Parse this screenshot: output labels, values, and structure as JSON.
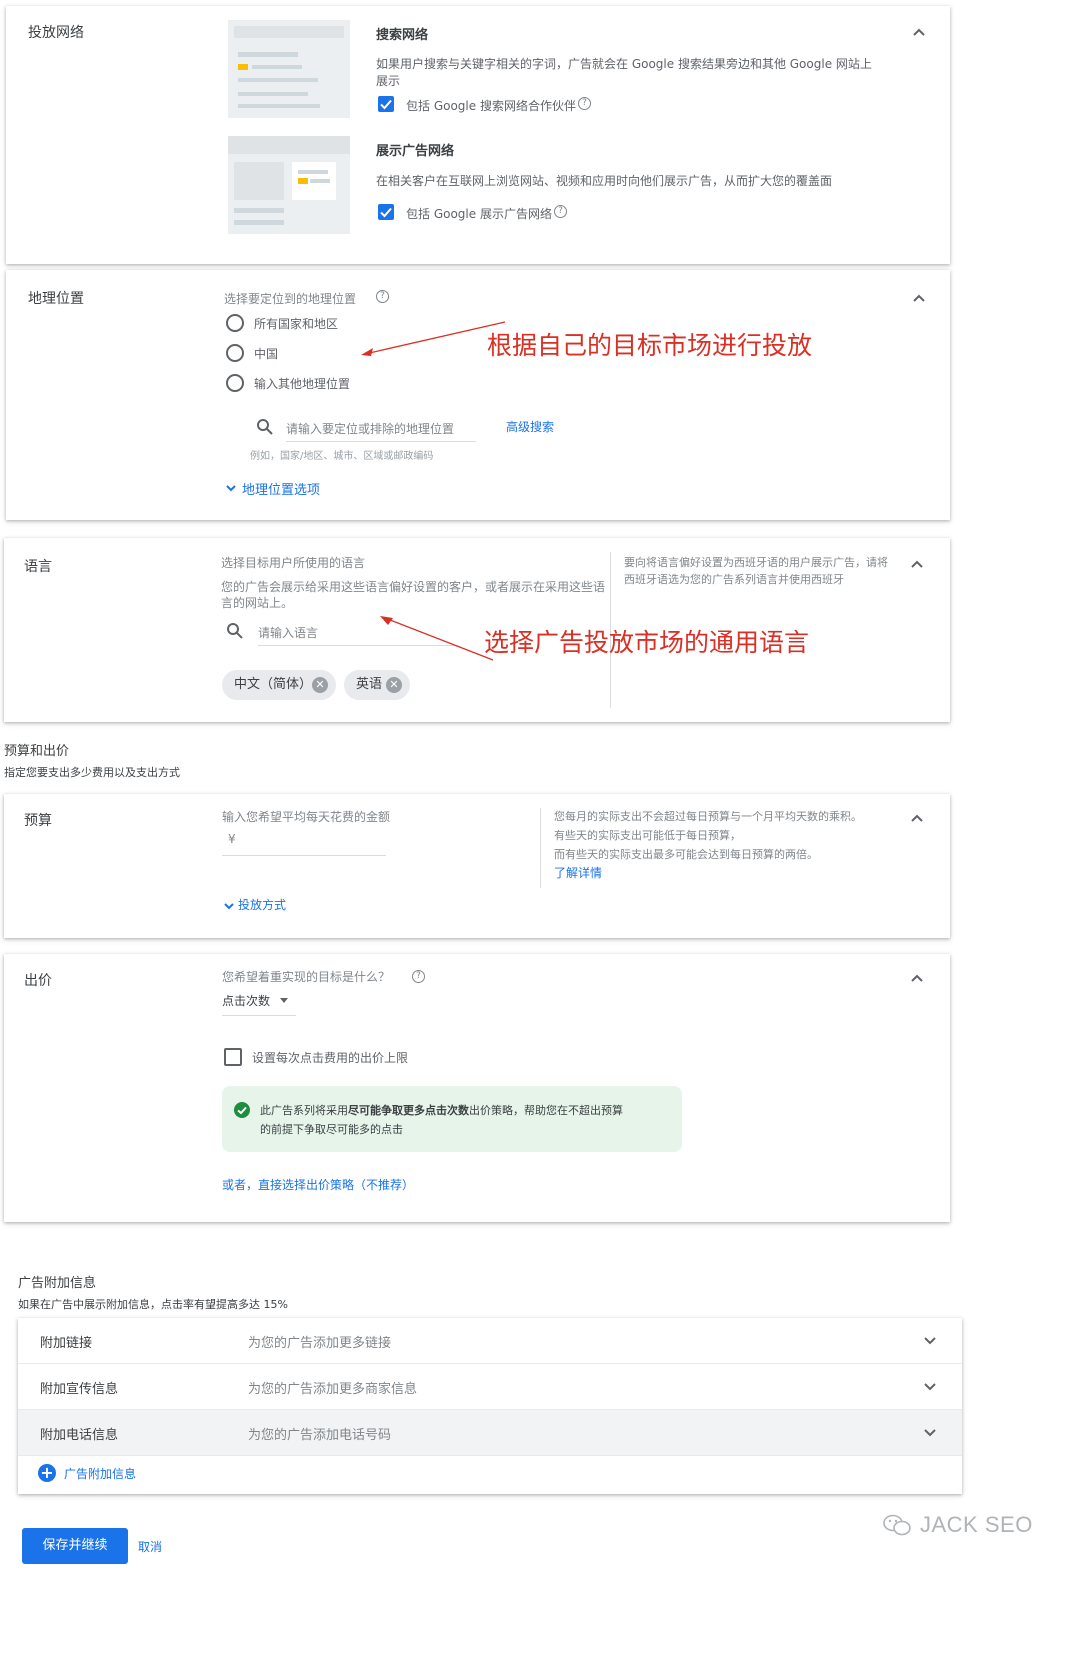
{
  "networks": {
    "section_title": "投放网络",
    "search": {
      "title": "搜索网络",
      "desc": "如果用户搜索与关键字相关的字词，广告就会在 Google 搜索结果旁边和其他 Google 网站上展示",
      "checkbox_label": "包括 Google 搜索网络合作伙伴"
    },
    "display": {
      "title": "展示广告网络",
      "desc": "在相关客户在互联网上浏览网站、视频和应用时向他们展示广告，从而扩大您的覆盖面",
      "checkbox_label": "包括 Google 展示广告网络"
    }
  },
  "location": {
    "section_title": "地理位置",
    "prompt": "选择要定位到的地理位置",
    "options": [
      "所有国家和地区",
      "中国",
      "输入其他地理位置"
    ],
    "search_placeholder": "请输入要定位或排除的地理位置",
    "advanced_search": "高级搜索",
    "example": "例如，国家/地区、城市、区域或邮政编码",
    "more_options": "地理位置选项",
    "annotation": "根据自己的目标市场进行投放"
  },
  "language": {
    "section_title": "语言",
    "prompt": "选择目标用户所使用的语言",
    "desc": "您的广告会展示给采用这些语言偏好设置的客户，或者展示在采用这些语言的网站上。",
    "search_placeholder": "请输入语言",
    "chips": [
      "中文（简体）",
      "英语"
    ],
    "side_note": "要向将语言偏好设置为西班牙语的用户展示广告，请将西班牙语选为您的广告系列语言并使用西班牙",
    "annotation": "选择广告投放市场的通用语言"
  },
  "budget_bidding": {
    "heading": "预算和出价",
    "subheading": "指定您要支出多少费用以及支出方式",
    "budget": {
      "section_title": "预算",
      "prompt": "输入您希望平均每天花费的金额",
      "currency": "¥",
      "delivery": "投放方式",
      "side_note_1": "您每月的实际支出不会超过每日预算与一个月平均天数的乘积。",
      "side_note_2": "有些天的实际支出可能低于每日预算，",
      "side_note_3": "而有些天的实际支出最多可能会达到每日预算的两倍。",
      "learn_more": "了解详情"
    },
    "bidding": {
      "section_title": "出价",
      "prompt": "您希望着重实现的目标是什么？",
      "selected": "点击次数",
      "cap_label": "设置每次点击费用的出价上限",
      "info_pre": "此广告系列将采用",
      "info_bold": "尽可能争取更多点击次数",
      "info_post": "出价策略，帮助您在不超出预算",
      "info_line2": "的前提下争取尽可能多的点击",
      "alt_link": "或者，直接选择出价策略（不推荐）"
    }
  },
  "extensions": {
    "heading": "广告附加信息",
    "subheading": "如果在广告中展示附加信息，点击率有望提高多达 15%",
    "rows": [
      {
        "label": "附加链接",
        "desc": "为您的广告添加更多链接"
      },
      {
        "label": "附加宣传信息",
        "desc": "为您的广告添加更多商家信息"
      },
      {
        "label": "附加电话信息",
        "desc": "为您的广告添加电话号码"
      }
    ],
    "add_label": "广告附加信息"
  },
  "footer": {
    "save": "保存并继续",
    "cancel": "取消",
    "watermark": "JACK SEO"
  },
  "colors": {
    "accent": "#1a73e8",
    "annotation": "#d93025",
    "success": "#1e8e3e",
    "info_bg": "#e6f4ea"
  }
}
